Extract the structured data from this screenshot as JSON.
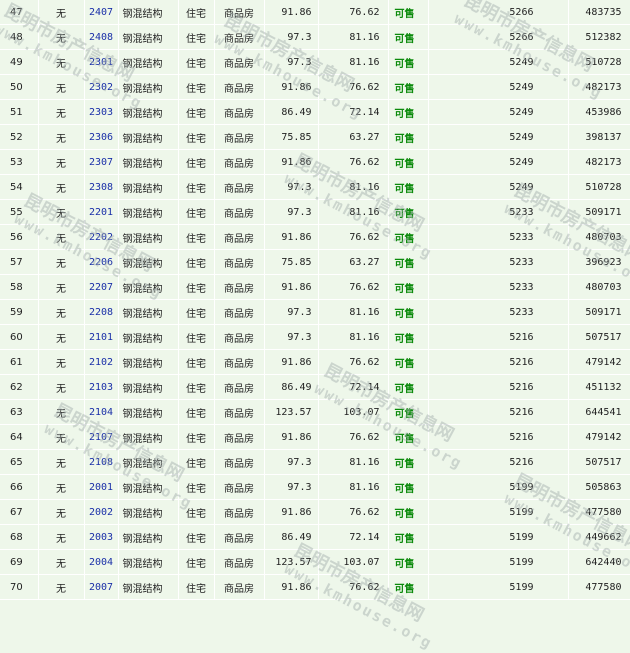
{
  "watermark": {
    "line1": "昆明市房产信息网",
    "line2": "www.kmhouse.org"
  },
  "status_color": "#0b8a0b",
  "room_color": "#1a2fa8",
  "rows": [
    {
      "seq": "47",
      "mortgage": "无",
      "room": "2407",
      "structure": "钢混结构",
      "use": "住宅",
      "type": "商品房",
      "build_area": "91.86",
      "inner_area": "76.62",
      "status": "可售",
      "unit_price": "5266",
      "total_price": "483735"
    },
    {
      "seq": "48",
      "mortgage": "无",
      "room": "2408",
      "structure": "钢混结构",
      "use": "住宅",
      "type": "商品房",
      "build_area": "97.3",
      "inner_area": "81.16",
      "status": "可售",
      "unit_price": "5266",
      "total_price": "512382"
    },
    {
      "seq": "49",
      "mortgage": "无",
      "room": "2301",
      "structure": "钢混结构",
      "use": "住宅",
      "type": "商品房",
      "build_area": "97.3",
      "inner_area": "81.16",
      "status": "可售",
      "unit_price": "5249",
      "total_price": "510728"
    },
    {
      "seq": "50",
      "mortgage": "无",
      "room": "2302",
      "structure": "钢混结构",
      "use": "住宅",
      "type": "商品房",
      "build_area": "91.86",
      "inner_area": "76.62",
      "status": "可售",
      "unit_price": "5249",
      "total_price": "482173"
    },
    {
      "seq": "51",
      "mortgage": "无",
      "room": "2303",
      "structure": "钢混结构",
      "use": "住宅",
      "type": "商品房",
      "build_area": "86.49",
      "inner_area": "72.14",
      "status": "可售",
      "unit_price": "5249",
      "total_price": "453986"
    },
    {
      "seq": "52",
      "mortgage": "无",
      "room": "2306",
      "structure": "钢混结构",
      "use": "住宅",
      "type": "商品房",
      "build_area": "75.85",
      "inner_area": "63.27",
      "status": "可售",
      "unit_price": "5249",
      "total_price": "398137"
    },
    {
      "seq": "53",
      "mortgage": "无",
      "room": "2307",
      "structure": "钢混结构",
      "use": "住宅",
      "type": "商品房",
      "build_area": "91.86",
      "inner_area": "76.62",
      "status": "可售",
      "unit_price": "5249",
      "total_price": "482173"
    },
    {
      "seq": "54",
      "mortgage": "无",
      "room": "2308",
      "structure": "钢混结构",
      "use": "住宅",
      "type": "商品房",
      "build_area": "97.3",
      "inner_area": "81.16",
      "status": "可售",
      "unit_price": "5249",
      "total_price": "510728"
    },
    {
      "seq": "55",
      "mortgage": "无",
      "room": "2201",
      "structure": "钢混结构",
      "use": "住宅",
      "type": "商品房",
      "build_area": "97.3",
      "inner_area": "81.16",
      "status": "可售",
      "unit_price": "5233",
      "total_price": "509171"
    },
    {
      "seq": "56",
      "mortgage": "无",
      "room": "2202",
      "structure": "钢混结构",
      "use": "住宅",
      "type": "商品房",
      "build_area": "91.86",
      "inner_area": "76.62",
      "status": "可售",
      "unit_price": "5233",
      "total_price": "480703"
    },
    {
      "seq": "57",
      "mortgage": "无",
      "room": "2206",
      "structure": "钢混结构",
      "use": "住宅",
      "type": "商品房",
      "build_area": "75.85",
      "inner_area": "63.27",
      "status": "可售",
      "unit_price": "5233",
      "total_price": "396923"
    },
    {
      "seq": "58",
      "mortgage": "无",
      "room": "2207",
      "structure": "钢混结构",
      "use": "住宅",
      "type": "商品房",
      "build_area": "91.86",
      "inner_area": "76.62",
      "status": "可售",
      "unit_price": "5233",
      "total_price": "480703"
    },
    {
      "seq": "59",
      "mortgage": "无",
      "room": "2208",
      "structure": "钢混结构",
      "use": "住宅",
      "type": "商品房",
      "build_area": "97.3",
      "inner_area": "81.16",
      "status": "可售",
      "unit_price": "5233",
      "total_price": "509171"
    },
    {
      "seq": "60",
      "mortgage": "无",
      "room": "2101",
      "structure": "钢混结构",
      "use": "住宅",
      "type": "商品房",
      "build_area": "97.3",
      "inner_area": "81.16",
      "status": "可售",
      "unit_price": "5216",
      "total_price": "507517"
    },
    {
      "seq": "61",
      "mortgage": "无",
      "room": "2102",
      "structure": "钢混结构",
      "use": "住宅",
      "type": "商品房",
      "build_area": "91.86",
      "inner_area": "76.62",
      "status": "可售",
      "unit_price": "5216",
      "total_price": "479142"
    },
    {
      "seq": "62",
      "mortgage": "无",
      "room": "2103",
      "structure": "钢混结构",
      "use": "住宅",
      "type": "商品房",
      "build_area": "86.49",
      "inner_area": "72.14",
      "status": "可售",
      "unit_price": "5216",
      "total_price": "451132"
    },
    {
      "seq": "63",
      "mortgage": "无",
      "room": "2104",
      "structure": "钢混结构",
      "use": "住宅",
      "type": "商品房",
      "build_area": "123.57",
      "inner_area": "103.07",
      "status": "可售",
      "unit_price": "5216",
      "total_price": "644541"
    },
    {
      "seq": "64",
      "mortgage": "无",
      "room": "2107",
      "structure": "钢混结构",
      "use": "住宅",
      "type": "商品房",
      "build_area": "91.86",
      "inner_area": "76.62",
      "status": "可售",
      "unit_price": "5216",
      "total_price": "479142"
    },
    {
      "seq": "65",
      "mortgage": "无",
      "room": "2108",
      "structure": "钢混结构",
      "use": "住宅",
      "type": "商品房",
      "build_area": "97.3",
      "inner_area": "81.16",
      "status": "可售",
      "unit_price": "5216",
      "total_price": "507517"
    },
    {
      "seq": "66",
      "mortgage": "无",
      "room": "2001",
      "structure": "钢混结构",
      "use": "住宅",
      "type": "商品房",
      "build_area": "97.3",
      "inner_area": "81.16",
      "status": "可售",
      "unit_price": "5199",
      "total_price": "505863"
    },
    {
      "seq": "67",
      "mortgage": "无",
      "room": "2002",
      "structure": "钢混结构",
      "use": "住宅",
      "type": "商品房",
      "build_area": "91.86",
      "inner_area": "76.62",
      "status": "可售",
      "unit_price": "5199",
      "total_price": "477580"
    },
    {
      "seq": "68",
      "mortgage": "无",
      "room": "2003",
      "structure": "钢混结构",
      "use": "住宅",
      "type": "商品房",
      "build_area": "86.49",
      "inner_area": "72.14",
      "status": "可售",
      "unit_price": "5199",
      "total_price": "449662"
    },
    {
      "seq": "69",
      "mortgage": "无",
      "room": "2004",
      "structure": "钢混结构",
      "use": "住宅",
      "type": "商品房",
      "build_area": "123.57",
      "inner_area": "103.07",
      "status": "可售",
      "unit_price": "5199",
      "total_price": "642440"
    },
    {
      "seq": "70",
      "mortgage": "无",
      "room": "2007",
      "structure": "钢混结构",
      "use": "住宅",
      "type": "商品房",
      "build_area": "91.86",
      "inner_area": "76.62",
      "status": "可售",
      "unit_price": "5199",
      "total_price": "477580"
    }
  ]
}
